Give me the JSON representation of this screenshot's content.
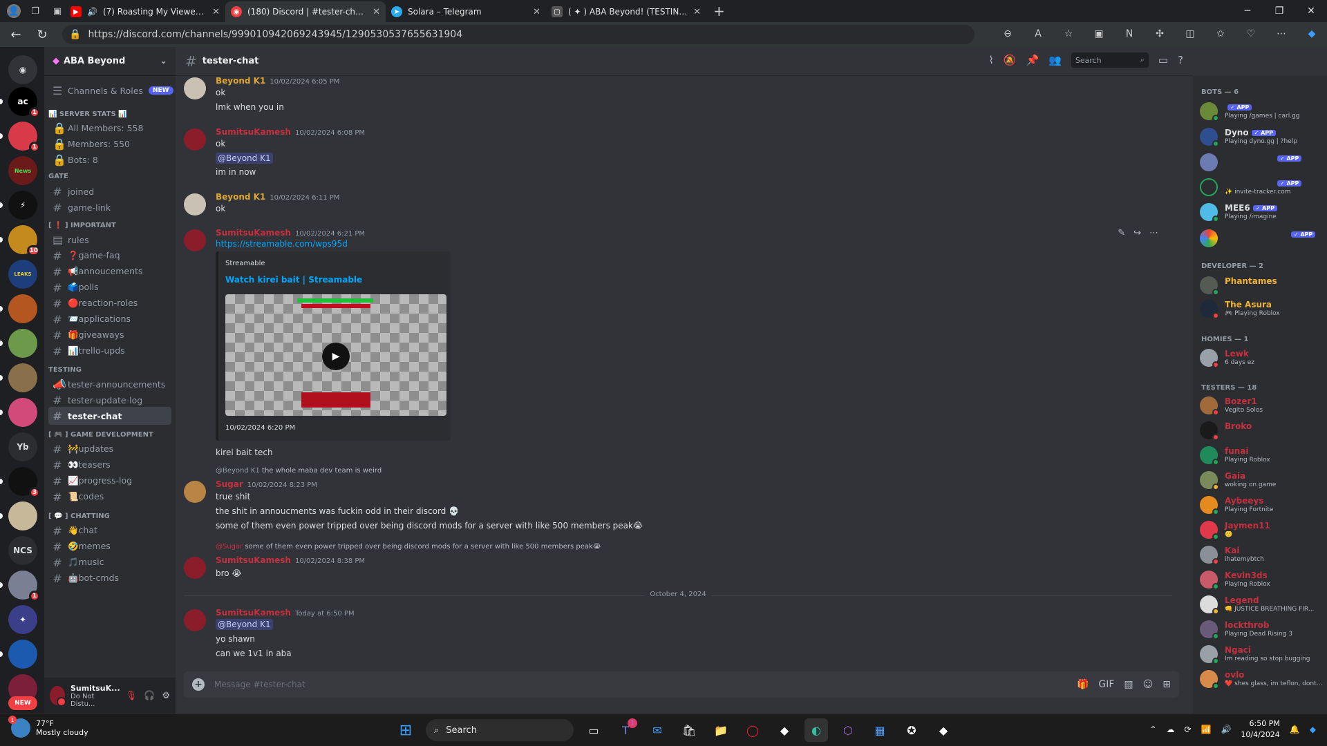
{
  "browser": {
    "tabs": [
      {
        "title": "(7) Roasting My Viewers Sel",
        "icon": "youtube-icon",
        "color": "#ff0000"
      },
      {
        "title": "(180) Discord | #tester-chat | ABA",
        "icon": "discord-icon",
        "color": "#5865f2"
      },
      {
        "title": "Solara – Telegram",
        "icon": "telegram-icon",
        "color": "#2aabee"
      },
      {
        "title": "( ✦ ) ABA Beyond! (TESTING ACC",
        "icon": "page-icon",
        "color": "#777777"
      }
    ],
    "url": "https://discord.com/channels/999010942069243945/1290530537655631904"
  },
  "server": {
    "name": "ABA Beyond",
    "channels_roles": "Channels & Roles",
    "new_badge": "NEW"
  },
  "sidebar": {
    "categories": {
      "server_stats": "📊 SERVER STATS 📊",
      "gate": "GATE",
      "important": "[ ❗ ] IMPORTANT",
      "testing": "TESTING",
      "game_dev": "[ 🎮 ] GAME DEVELOPMENT",
      "chatting": "[ 💬 ] CHATTING"
    },
    "stats": [
      "All Members: 558",
      "Members: 550",
      "Bots: 8"
    ],
    "gate": [
      "joined",
      "game-link"
    ],
    "important": [
      "rules",
      "❓game-faq",
      "📢annoucements",
      "🗳️polls",
      "🔴reaction-roles",
      "📨applications",
      "🎁giveaways",
      "📊trello-upds"
    ],
    "testing": [
      "tester-announcements",
      "tester-update-log",
      "tester-chat"
    ],
    "game_dev": [
      "🚧updates",
      "👀teasers",
      "📈progress-log",
      "📜codes"
    ],
    "chatting": [
      "👋chat",
      "🤣memes",
      "🎵music",
      "🤖bot-cmds"
    ]
  },
  "user_panel": {
    "name": "SumitsuK...",
    "status": "Do Not Distu..."
  },
  "guilds": {
    "ac": "ac",
    "yb": "Yb",
    "ncs": "NCS",
    "new": "NEW",
    "badges": [
      "1",
      "1",
      "10",
      "3",
      "1"
    ]
  },
  "chat": {
    "channel": "tester-chat",
    "search_placeholder": "Search",
    "composer_placeholder": "Message #tester-chat",
    "date_divider": "October 4, 2024",
    "messages": [
      {
        "author": "Beyond K1",
        "time": "10/02/2024 6:05 PM",
        "lines": [
          "ok",
          "lmk when you in"
        ]
      },
      {
        "author": "SumitsuKamesh",
        "time": "10/02/2024 6:08 PM",
        "lines": [
          "ok",
          "@Beyond K1",
          "im in now"
        ]
      },
      {
        "author": "Beyond K1",
        "time": "10/02/2024 6:11 PM",
        "lines": [
          "ok"
        ]
      },
      {
        "author": "SumitsuKamesh",
        "time": "10/02/2024 6:21 PM",
        "link": "https://streamable.com/wps95d",
        "after": "kirei bait tech"
      },
      {
        "author": "Sugar",
        "time": "10/02/2024 8:23 PM",
        "reply_name": "@Beyond K1",
        "reply_text": "the whole maba dev team is weird",
        "lines": [
          "true shit",
          "the shit in annoucments was fuckin odd in their discord 💀",
          "some of them even power tripped over being discord mods for a server with like 500 members peak😭"
        ]
      },
      {
        "author": "SumitsuKamesh",
        "time": "10/02/2024 8:38 PM",
        "reply_name": "@Sugar",
        "reply_text": "some of them even power tripped over being discord mods for a server with like 500 members peak😭",
        "lines": [
          "bro 😭"
        ]
      },
      {
        "author": "SumitsuKamesh",
        "time": "Today at 6:50 PM",
        "lines": [
          "@Beyond K1",
          "yo shawn",
          "can we 1v1 in aba"
        ]
      }
    ],
    "embed": {
      "provider": "Streamable",
      "title": "Watch kirei bait | Streamable",
      "footer": "10/02/2024 6:20 PM"
    }
  },
  "members": {
    "app_badge": "✓ APP",
    "groups": [
      {
        "title": "BOTS — 6",
        "items": [
          {
            "name": "",
            "status": "Playing /games | carl.gg",
            "app": true
          },
          {
            "name": "Dyno",
            "status": "Playing dyno.gg | ?help",
            "app": true
          },
          {
            "name": "",
            "status": "",
            "app": true
          },
          {
            "name": "",
            "status": "✨ invite-tracker.com",
            "app": true
          },
          {
            "name": "MEE6",
            "status": "Playing /imagine",
            "app": true
          },
          {
            "name": "",
            "status": "",
            "app": true
          }
        ]
      },
      {
        "title": "DEVELOPER — 2",
        "items": [
          {
            "name": "Phantames",
            "status": ""
          },
          {
            "name": "The Asura",
            "status": "🎮 Playing Roblox"
          }
        ]
      },
      {
        "title": "HOMIES — 1",
        "items": [
          {
            "name": "Lewk",
            "status": "6 days ez"
          }
        ]
      },
      {
        "title": "TESTERS — 18",
        "items": [
          {
            "name": "Bozer1",
            "status": "Vegito Solos"
          },
          {
            "name": "Broko",
            "status": ""
          },
          {
            "name": "funai",
            "status": "Playing Roblox"
          },
          {
            "name": "Gaia",
            "status": "woking on game"
          },
          {
            "name": "Aybeeys",
            "status": "Playing Fortnite"
          },
          {
            "name": "Jaymen11",
            "status": "🙂"
          },
          {
            "name": "Kai",
            "status": "ihatemybtch"
          },
          {
            "name": "Kevin3ds",
            "status": "Playing Roblox"
          },
          {
            "name": "Legend",
            "status": "👊 JUSTICE BREATHING FIR..."
          },
          {
            "name": "lockthrob",
            "status": "Playing Dead Rising 3"
          },
          {
            "name": "Ngaci",
            "status": "Im reading so stop bugging"
          },
          {
            "name": "ovlo",
            "status": "❤️ shes glass, im teflon, dont..."
          }
        ]
      }
    ]
  },
  "taskbar": {
    "temp": "77°F",
    "weather": "Mostly cloudy",
    "weather_badge": "1",
    "search": "Search",
    "time": "6:50 PM",
    "date": "10/4/2024",
    "teams_badge": "1"
  },
  "colors": {
    "discord_bg": "#313338",
    "sidebar_bg": "#2b2d31",
    "guild_bg": "#1e1f22",
    "accent": "#5865f2",
    "dev_gold": "#f0b232",
    "red_role": "#c6303e",
    "link": "#00a8fc"
  }
}
